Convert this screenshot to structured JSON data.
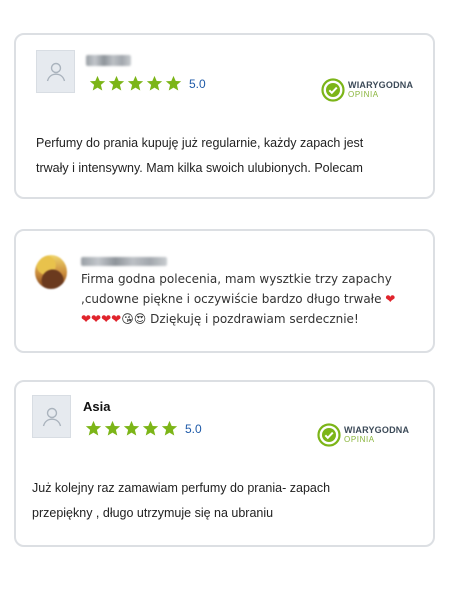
{
  "reviews": [
    {
      "author": "",
      "author_blurred": true,
      "avatar": "user-silhouette-icon",
      "stars": 5,
      "rating_text": "5.0",
      "badge": {
        "line1": "WIARYGODNA",
        "line2": "OPINIA",
        "icon": "verified-check-icon"
      },
      "text_lines": [
        "Perfumy do prania kupuję już regularnie, każdy zapach jest",
        "trwały i intensywny. Mam kilka swoich ulubionych. Polecam"
      ]
    },
    {
      "author": "",
      "author_blurred": true,
      "avatar": "photo-avatar",
      "text_lines": [
        "Firma godna polecenia, mam wysztkie trzy zapachy",
        ",cudowne piękne i oczywiście bardzo długo trwałe",
        "Dziękuję i pozdrawiam serdecznie!"
      ],
      "emojis": [
        "❤",
        "❤❤❤❤",
        "😘😍"
      ]
    },
    {
      "author": "Asia",
      "author_blurred": false,
      "avatar": "user-silhouette-icon",
      "stars": 5,
      "rating_text": "5.0",
      "badge": {
        "line1": "WIARYGODNA",
        "line2": "OPINIA",
        "icon": "verified-check-icon"
      },
      "text_lines": [
        "Już kolejny raz zamawiam perfumy do prania- zapach",
        "przepiękny , długo utrzymuje się na ubraniu"
      ]
    }
  ],
  "colors": {
    "star": "#7cb518",
    "rating": "#1e5aa8",
    "badge_green": "#7cb518",
    "card_border": "#dcdfe3",
    "heart": "#e0242c"
  }
}
